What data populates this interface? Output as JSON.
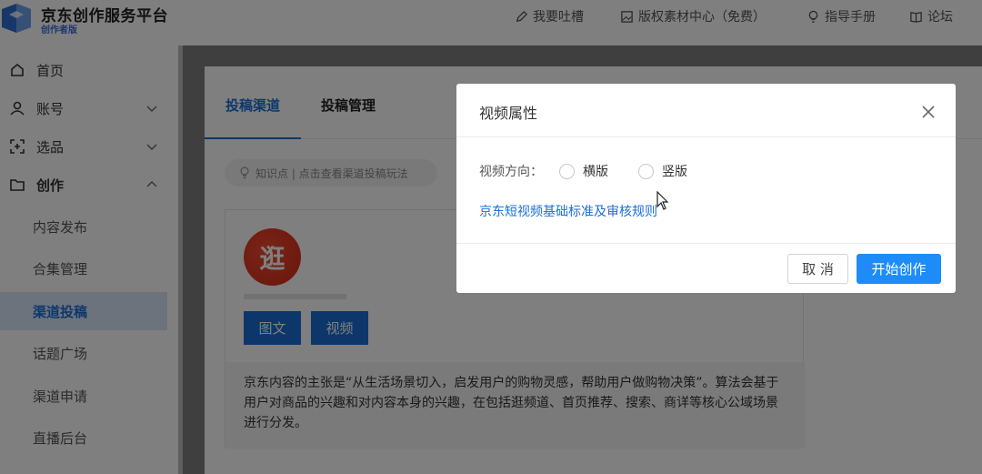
{
  "brand": {
    "title": "京东创作服务平台",
    "subtitle": "创作者版"
  },
  "topnav": [
    {
      "label": "我要吐槽",
      "icon": "pencil-icon"
    },
    {
      "label": "版权素材中心（免费）",
      "icon": "image-icon"
    },
    {
      "label": "指导手册",
      "icon": "lightbulb-icon"
    },
    {
      "label": "论坛",
      "icon": "book-icon"
    }
  ],
  "sidebar": {
    "items": [
      {
        "label": "首页",
        "icon": "home-icon"
      },
      {
        "label": "账号",
        "icon": "user-icon"
      },
      {
        "label": "选品",
        "icon": "select-product-icon"
      },
      {
        "label": "创作",
        "icon": "folder-icon"
      }
    ],
    "sub_items": [
      {
        "label": "内容发布"
      },
      {
        "label": "合集管理"
      },
      {
        "label": "渠道投稿"
      },
      {
        "label": "话题广场"
      },
      {
        "label": "渠道申请"
      },
      {
        "label": "直播后台"
      }
    ]
  },
  "tabs": [
    {
      "label": "投稿渠道"
    },
    {
      "label": "投稿管理"
    }
  ],
  "tip": {
    "text": "知识点 | 点击查看渠道投稿玩法",
    "icon": "lightbulb-icon"
  },
  "channel_card": {
    "icon_text": "逛",
    "buttons": [
      {
        "label": "图文"
      },
      {
        "label": "视频"
      }
    ],
    "description": "京东内容的主张是“从生活场景切入，启发用户的购物灵感，帮助用户做购物决策”。算法会基于用户对商品的兴趣和对内容本身的兴趣，在包括逛频道、首页推荐、搜索、商详等核心公域场景进行分发。"
  },
  "modal": {
    "title": "视频属性",
    "field_label": "视频方向：",
    "options": [
      {
        "label": "横版"
      },
      {
        "label": "竖版"
      }
    ],
    "rule_link": "京东短视频基础标准及审核规则",
    "cancel_label": "取 消",
    "confirm_label": "开始创作"
  },
  "colors": {
    "primary": "#1a6fd6",
    "primary_button": "#1d8cf8",
    "overlay": "rgba(0,0,0,0.5)"
  }
}
